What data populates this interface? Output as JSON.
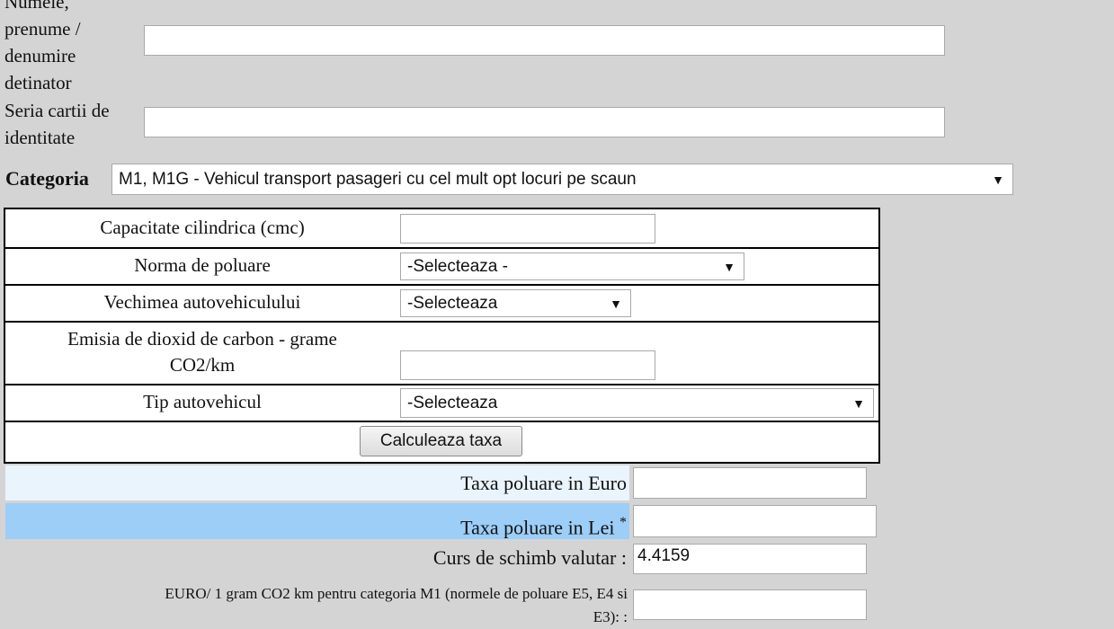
{
  "owner": {
    "name_label_lines": [
      "Numele,",
      "prenume /",
      "denumire",
      "detinator"
    ],
    "name_value": "",
    "id_label_lines": [
      "Seria cartii de",
      "identitate"
    ],
    "id_value": ""
  },
  "category": {
    "label": "Categoria",
    "selected": "M1, M1G - Vehicul transport pasageri cu cel mult opt locuri pe scaun"
  },
  "form": {
    "capacity_label": "Capacitate cilindrica (cmc)",
    "capacity_value": "",
    "emission_norm_label": "Norma de poluare",
    "emission_norm_selected": "-Selecteaza -",
    "age_label": "Vechimea autovehiculului",
    "age_selected": "-Selecteaza",
    "co2_label_lines": [
      "Emisia de dioxid de carbon  - grame",
      "CO2/km"
    ],
    "co2_value": "",
    "vehicle_type_label": "Tip autovehicul",
    "vehicle_type_selected": "-Selecteaza",
    "calculate_button": "Calculeaza taxa"
  },
  "results": {
    "euro_label": "Taxa poluare in Euro",
    "euro_value": "",
    "lei_label": "Taxa poluare in Lei",
    "lei_asterisk": "*",
    "lei_value": "",
    "exchange_label": "Curs de schimb valutar :",
    "exchange_value": "4.4159",
    "euro_per_gram_label_lines": [
      "EURO/ 1 gram CO2 km pentru categoria M1 (normele de poluare E5, E4 si",
      "E3): :"
    ],
    "euro_per_gram_value": ""
  },
  "colors": {
    "background": "#d4d4d4",
    "euro_row_bg": "#eaf4fc",
    "lei_row_bg": "#9ccef8"
  },
  "icons": {
    "dropdown": "caret-down-icon"
  }
}
